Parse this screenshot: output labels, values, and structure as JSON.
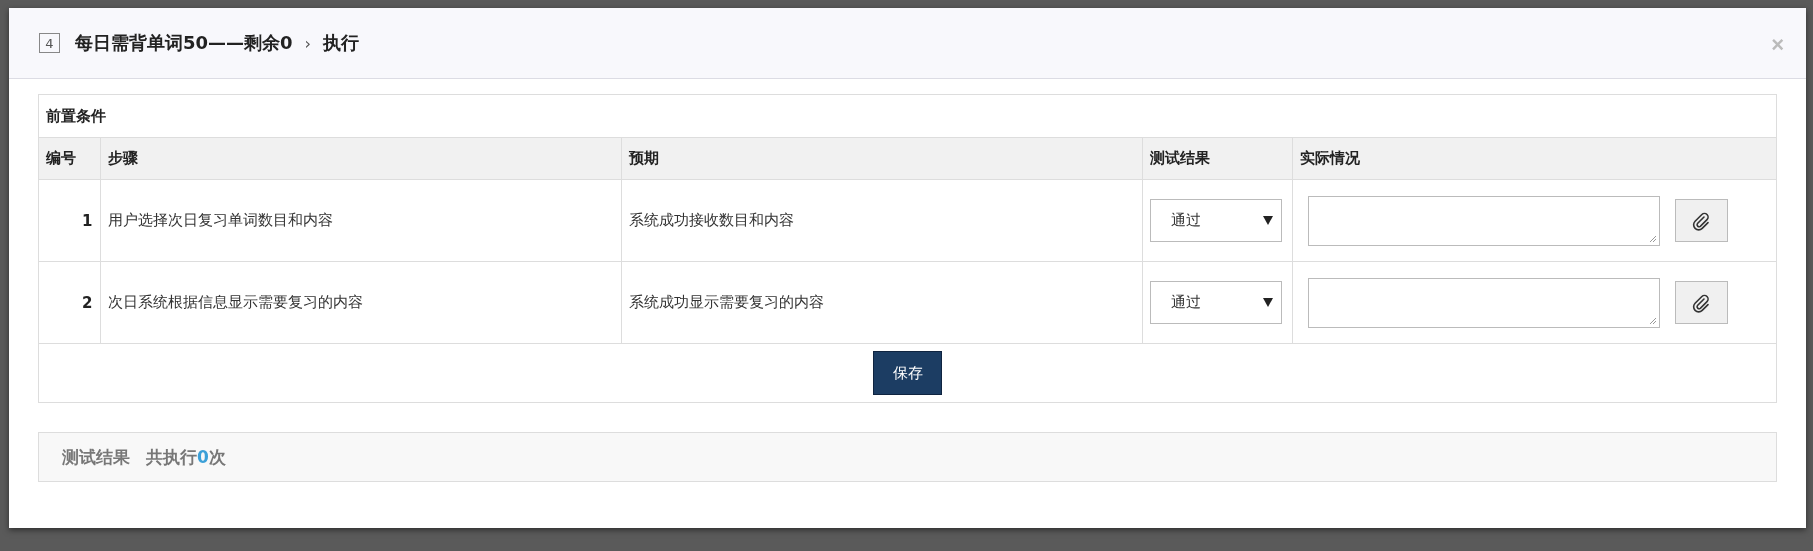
{
  "dialog": {
    "index": "4",
    "title": "每日需背单词50——剩余0",
    "breadcrumb_separator": "›",
    "current": "执行",
    "close": "×"
  },
  "precondition": {
    "label": "前置条件"
  },
  "table": {
    "columns": [
      "编号",
      "步骤",
      "预期",
      "测试结果",
      "实际情况"
    ],
    "rows": [
      {
        "number": "1",
        "step": "用户选择次日复习单词数目和内容",
        "expected": "系统成功接收数目和内容",
        "result": "通过"
      },
      {
        "number": "2",
        "step": "次日系统根据信息显示需要复习的内容",
        "expected": "系统成功显示需要复习的内容",
        "result": "通过"
      }
    ]
  },
  "save_button": "保存",
  "results_panel": {
    "label": "测试结果",
    "count_prefix": "共执行",
    "count": "0",
    "count_suffix": "次"
  }
}
